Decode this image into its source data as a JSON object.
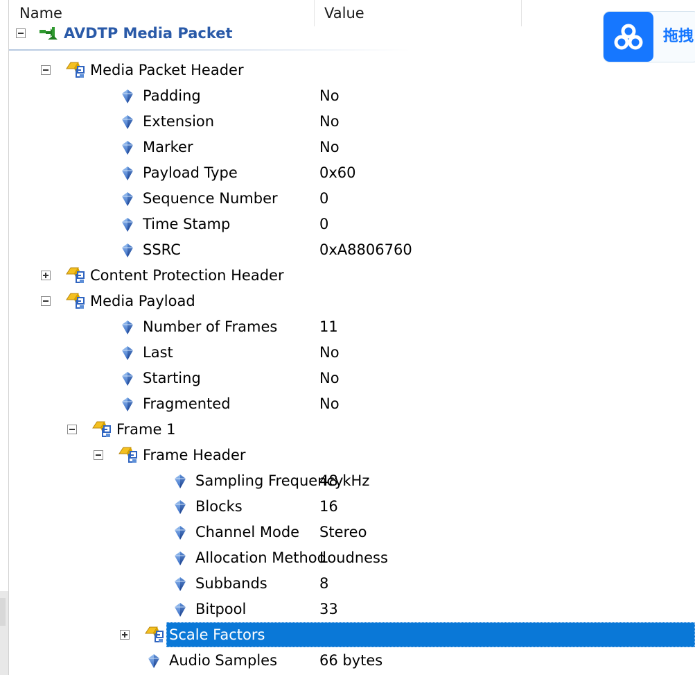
{
  "columns": {
    "name": "Name",
    "value": "Value"
  },
  "root": {
    "label": "AVDTP Media Packet"
  },
  "widget": {
    "label": "拖拽",
    "icon": "cloud-icon"
  },
  "tree": [
    {
      "label": "Media Packet Header",
      "value": "",
      "kind": "group",
      "expander": "minus"
    },
    {
      "label": "Padding",
      "value": "No",
      "kind": "field"
    },
    {
      "label": "Extension",
      "value": "No",
      "kind": "field"
    },
    {
      "label": "Marker",
      "value": "No",
      "kind": "field"
    },
    {
      "label": "Payload Type",
      "value": "0x60",
      "kind": "field"
    },
    {
      "label": "Sequence Number",
      "value": "0",
      "kind": "field"
    },
    {
      "label": "Time Stamp",
      "value": "0",
      "kind": "field"
    },
    {
      "label": "SSRC",
      "value": "0xA8806760",
      "kind": "field"
    },
    {
      "label": "Content Protection Header",
      "value": "",
      "kind": "group",
      "expander": "plus"
    },
    {
      "label": "Media Payload",
      "value": "",
      "kind": "group",
      "expander": "minus"
    },
    {
      "label": "Number of Frames",
      "value": "11",
      "kind": "field"
    },
    {
      "label": "Last",
      "value": "No",
      "kind": "field"
    },
    {
      "label": "Starting",
      "value": "No",
      "kind": "field"
    },
    {
      "label": "Fragmented",
      "value": "No",
      "kind": "field"
    },
    {
      "label": "Frame 1",
      "value": "",
      "kind": "group",
      "expander": "minus"
    },
    {
      "label": "Frame Header",
      "value": "",
      "kind": "group",
      "expander": "minus"
    },
    {
      "label": "Sampling Frequency",
      "value": "48 kHz",
      "kind": "field"
    },
    {
      "label": "Blocks",
      "value": "16",
      "kind": "field"
    },
    {
      "label": "Channel Mode",
      "value": "Stereo",
      "kind": "field"
    },
    {
      "label": "Allocation Method",
      "value": "Loudness",
      "kind": "field"
    },
    {
      "label": "Subbands",
      "value": "8",
      "kind": "field"
    },
    {
      "label": "Bitpool",
      "value": "33",
      "kind": "field"
    },
    {
      "label": "Scale Factors",
      "value": "",
      "kind": "group",
      "expander": "plus",
      "selected": true
    },
    {
      "label": "Audio Samples",
      "value": "66 bytes",
      "kind": "field"
    }
  ]
}
